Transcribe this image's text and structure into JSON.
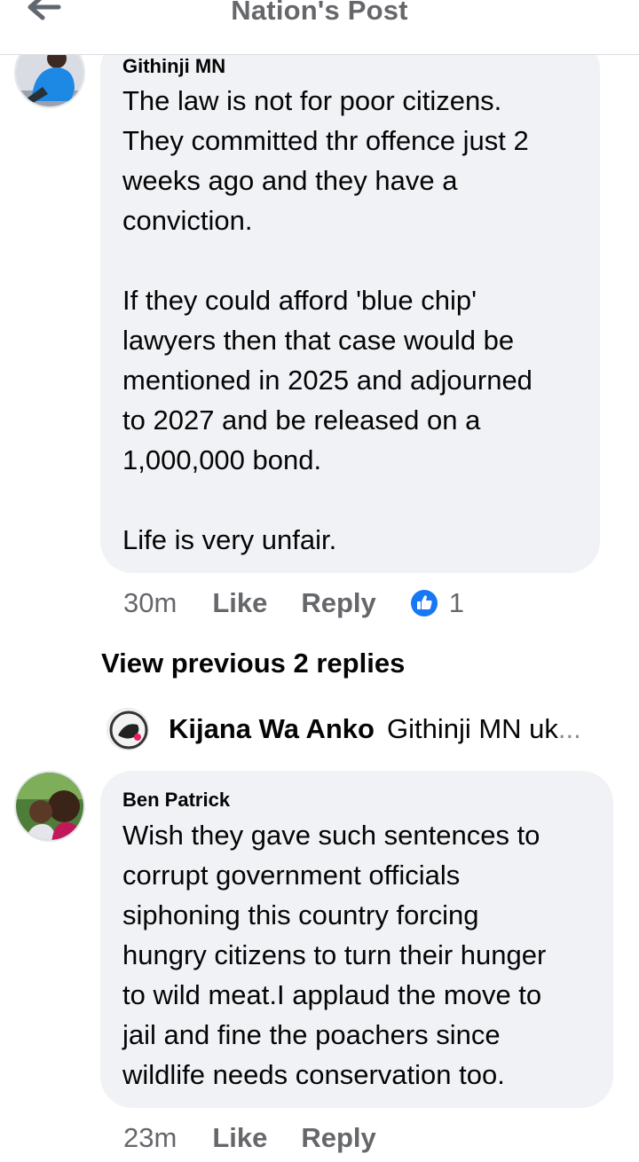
{
  "header": {
    "title": "Nation's Post"
  },
  "comments": [
    {
      "author": "Githinji MN",
      "text": "The law is not for poor citizens.\nThey committed thr offence just 2\nweeks ago and they have a\nconviction.\n\nIf they could afford 'blue chip'\nlawyers then that case would be\nmentioned in 2025 and adjourned\nto 2027 and be released on a\n1,000,000 bond.\n\nLife is very unfair.",
      "time": "30m",
      "like_label": "Like",
      "reply_label": "Reply",
      "reaction_count": "1",
      "reaction_color": "#1877f2"
    },
    {
      "author": "Ben Patrick",
      "text": "Wish they gave such sentences to\ncorrupt government officials\nsiphoning this country forcing\nhungry citizens to turn their hunger\nto wild meat.I applaud the move to\njail and fine the poachers since\nwildlife needs conservation too.",
      "time": "23m",
      "like_label": "Like",
      "reply_label": "Reply"
    }
  ],
  "replies": {
    "view_previous_label": "View previous 2 replies",
    "latest": {
      "author": "Kijana Wa Anko",
      "text": "Githinji MN uk",
      "ellipsis": "..."
    }
  },
  "icons": {
    "back": "arrow-left-icon",
    "like_reaction": "thumbs-up-icon"
  }
}
